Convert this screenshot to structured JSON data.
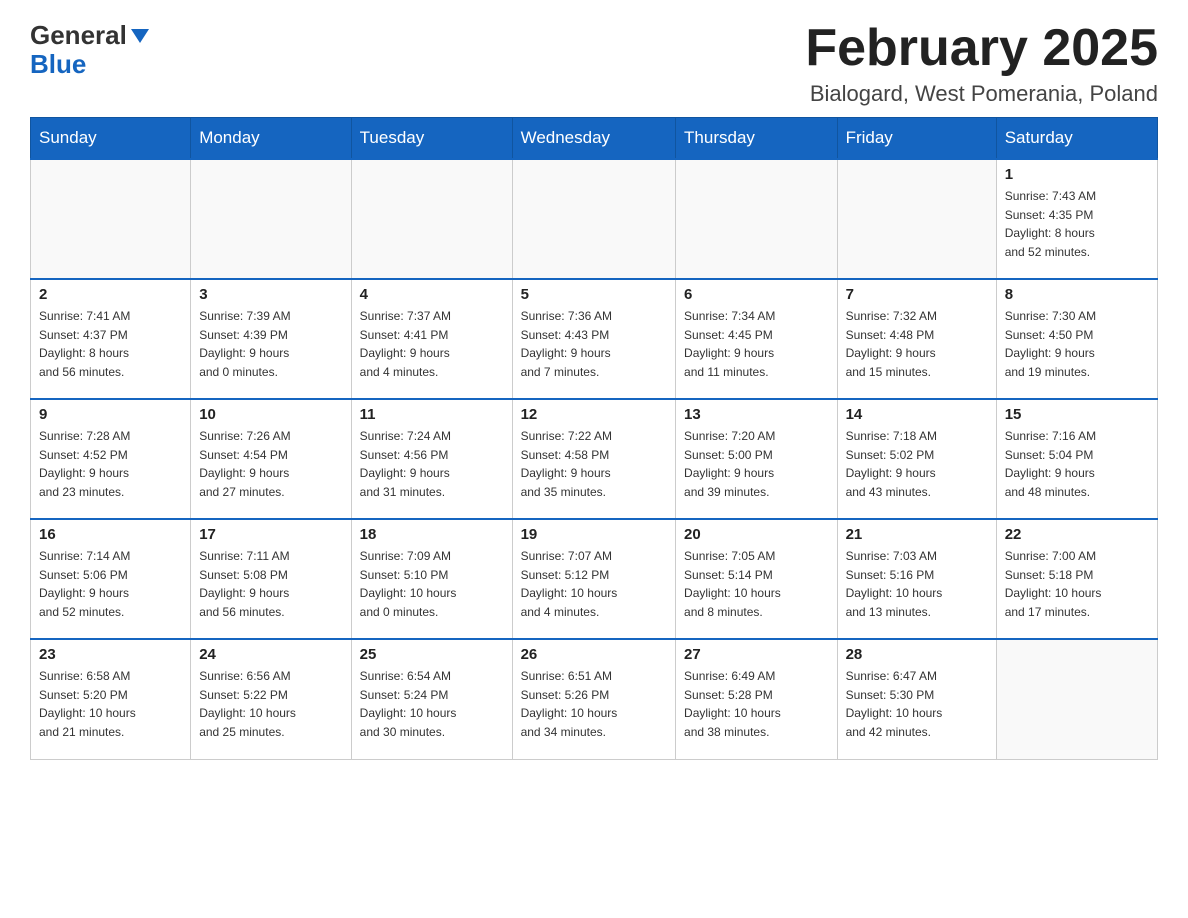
{
  "header": {
    "logo": {
      "part1": "General",
      "part2": "Blue"
    },
    "title": "February 2025",
    "location": "Bialogard, West Pomerania, Poland"
  },
  "days_of_week": [
    "Sunday",
    "Monday",
    "Tuesday",
    "Wednesday",
    "Thursday",
    "Friday",
    "Saturday"
  ],
  "weeks": [
    [
      {
        "day": "",
        "info": ""
      },
      {
        "day": "",
        "info": ""
      },
      {
        "day": "",
        "info": ""
      },
      {
        "day": "",
        "info": ""
      },
      {
        "day": "",
        "info": ""
      },
      {
        "day": "",
        "info": ""
      },
      {
        "day": "1",
        "info": "Sunrise: 7:43 AM\nSunset: 4:35 PM\nDaylight: 8 hours\nand 52 minutes."
      }
    ],
    [
      {
        "day": "2",
        "info": "Sunrise: 7:41 AM\nSunset: 4:37 PM\nDaylight: 8 hours\nand 56 minutes."
      },
      {
        "day": "3",
        "info": "Sunrise: 7:39 AM\nSunset: 4:39 PM\nDaylight: 9 hours\nand 0 minutes."
      },
      {
        "day": "4",
        "info": "Sunrise: 7:37 AM\nSunset: 4:41 PM\nDaylight: 9 hours\nand 4 minutes."
      },
      {
        "day": "5",
        "info": "Sunrise: 7:36 AM\nSunset: 4:43 PM\nDaylight: 9 hours\nand 7 minutes."
      },
      {
        "day": "6",
        "info": "Sunrise: 7:34 AM\nSunset: 4:45 PM\nDaylight: 9 hours\nand 11 minutes."
      },
      {
        "day": "7",
        "info": "Sunrise: 7:32 AM\nSunset: 4:48 PM\nDaylight: 9 hours\nand 15 minutes."
      },
      {
        "day": "8",
        "info": "Sunrise: 7:30 AM\nSunset: 4:50 PM\nDaylight: 9 hours\nand 19 minutes."
      }
    ],
    [
      {
        "day": "9",
        "info": "Sunrise: 7:28 AM\nSunset: 4:52 PM\nDaylight: 9 hours\nand 23 minutes."
      },
      {
        "day": "10",
        "info": "Sunrise: 7:26 AM\nSunset: 4:54 PM\nDaylight: 9 hours\nand 27 minutes."
      },
      {
        "day": "11",
        "info": "Sunrise: 7:24 AM\nSunset: 4:56 PM\nDaylight: 9 hours\nand 31 minutes."
      },
      {
        "day": "12",
        "info": "Sunrise: 7:22 AM\nSunset: 4:58 PM\nDaylight: 9 hours\nand 35 minutes."
      },
      {
        "day": "13",
        "info": "Sunrise: 7:20 AM\nSunset: 5:00 PM\nDaylight: 9 hours\nand 39 minutes."
      },
      {
        "day": "14",
        "info": "Sunrise: 7:18 AM\nSunset: 5:02 PM\nDaylight: 9 hours\nand 43 minutes."
      },
      {
        "day": "15",
        "info": "Sunrise: 7:16 AM\nSunset: 5:04 PM\nDaylight: 9 hours\nand 48 minutes."
      }
    ],
    [
      {
        "day": "16",
        "info": "Sunrise: 7:14 AM\nSunset: 5:06 PM\nDaylight: 9 hours\nand 52 minutes."
      },
      {
        "day": "17",
        "info": "Sunrise: 7:11 AM\nSunset: 5:08 PM\nDaylight: 9 hours\nand 56 minutes."
      },
      {
        "day": "18",
        "info": "Sunrise: 7:09 AM\nSunset: 5:10 PM\nDaylight: 10 hours\nand 0 minutes."
      },
      {
        "day": "19",
        "info": "Sunrise: 7:07 AM\nSunset: 5:12 PM\nDaylight: 10 hours\nand 4 minutes."
      },
      {
        "day": "20",
        "info": "Sunrise: 7:05 AM\nSunset: 5:14 PM\nDaylight: 10 hours\nand 8 minutes."
      },
      {
        "day": "21",
        "info": "Sunrise: 7:03 AM\nSunset: 5:16 PM\nDaylight: 10 hours\nand 13 minutes."
      },
      {
        "day": "22",
        "info": "Sunrise: 7:00 AM\nSunset: 5:18 PM\nDaylight: 10 hours\nand 17 minutes."
      }
    ],
    [
      {
        "day": "23",
        "info": "Sunrise: 6:58 AM\nSunset: 5:20 PM\nDaylight: 10 hours\nand 21 minutes."
      },
      {
        "day": "24",
        "info": "Sunrise: 6:56 AM\nSunset: 5:22 PM\nDaylight: 10 hours\nand 25 minutes."
      },
      {
        "day": "25",
        "info": "Sunrise: 6:54 AM\nSunset: 5:24 PM\nDaylight: 10 hours\nand 30 minutes."
      },
      {
        "day": "26",
        "info": "Sunrise: 6:51 AM\nSunset: 5:26 PM\nDaylight: 10 hours\nand 34 minutes."
      },
      {
        "day": "27",
        "info": "Sunrise: 6:49 AM\nSunset: 5:28 PM\nDaylight: 10 hours\nand 38 minutes."
      },
      {
        "day": "28",
        "info": "Sunrise: 6:47 AM\nSunset: 5:30 PM\nDaylight: 10 hours\nand 42 minutes."
      },
      {
        "day": "",
        "info": ""
      }
    ]
  ]
}
